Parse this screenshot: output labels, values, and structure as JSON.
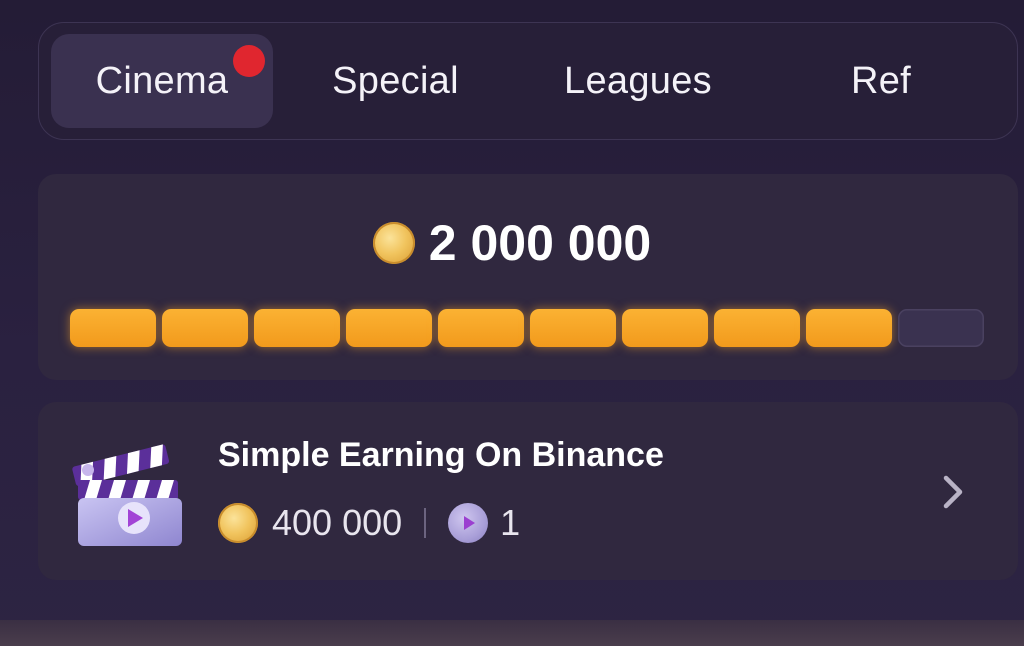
{
  "tabs": [
    {
      "label": "Cinema",
      "active": true,
      "notification": true
    },
    {
      "label": "Special",
      "active": false
    },
    {
      "label": "Leagues",
      "active": false
    },
    {
      "label": "Ref",
      "active": false
    }
  ],
  "progress": {
    "amount": "2 000 000",
    "segments_total": 10,
    "segments_filled": 9,
    "fill_color": "#f5a623"
  },
  "task": {
    "title": "Simple Earning On Binance",
    "coin_reward": "400 000",
    "ticket_reward": "1",
    "icon": "clapperboard-icon"
  },
  "colors": {
    "accent": "#f5a623",
    "notification": "#e0262f",
    "background": "#241c36"
  }
}
